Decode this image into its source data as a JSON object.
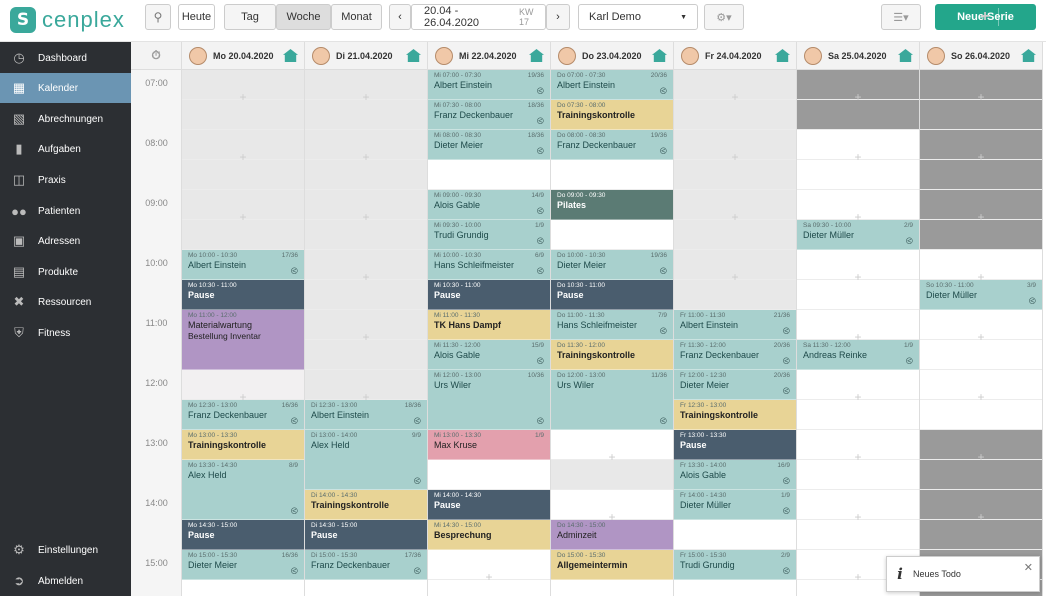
{
  "topbar": {
    "logo_text": "cenplex",
    "today": "Heute",
    "views": [
      "Tag",
      "Woche",
      "Monat"
    ],
    "range": "20.04 - 26.04.2020",
    "week": "KW 17",
    "user": "Karl Demo",
    "new_series": "Neue Serie"
  },
  "sidebar": {
    "items": [
      {
        "label": "Dashboard",
        "icon": "dashboard-icon"
      },
      {
        "label": "Kalender",
        "icon": "calendar-icon"
      },
      {
        "label": "Abrechnungen",
        "icon": "calculator-icon"
      },
      {
        "label": "Aufgaben",
        "icon": "clipboard-icon"
      },
      {
        "label": "Praxis",
        "icon": "building-icon"
      },
      {
        "label": "Patienten",
        "icon": "users-icon"
      },
      {
        "label": "Adressen",
        "icon": "contact-icon"
      },
      {
        "label": "Produkte",
        "icon": "store-icon"
      },
      {
        "label": "Ressourcen",
        "icon": "tools-icon"
      },
      {
        "label": "Fitness",
        "icon": "shield-icon"
      }
    ],
    "bottom": [
      {
        "label": "Einstellungen",
        "icon": "gear-icon"
      },
      {
        "label": "Abmelden",
        "icon": "logout-icon"
      }
    ]
  },
  "times": [
    "07:00",
    "08:00",
    "09:00",
    "10:00",
    "11:00",
    "12:00",
    "13:00",
    "14:00",
    "15:00"
  ],
  "days": [
    {
      "label": "Mo 20.04.2020",
      "home_count": "1"
    },
    {
      "label": "Di 21.04.2020",
      "home_count": "1"
    },
    {
      "label": "Mi 22.04.2020",
      "home_count": "1"
    },
    {
      "label": "Do 23.04.2020",
      "home_count": "1"
    },
    {
      "label": "Fr 24.04.2020",
      "home_count": "1"
    },
    {
      "label": "Sa 25.04.2020",
      "home_count": "1"
    },
    {
      "label": "So 26.04.2020",
      "home_count": "1"
    }
  ],
  "events": [
    {
      "day": 0,
      "slot": 6,
      "color": "teal",
      "time": "Mo 10:00 - 10:30",
      "count": "17/36",
      "name": "Albert Einstein"
    },
    {
      "day": 0,
      "slot": 7,
      "color": "dark",
      "time": "Mo 10:30 - 11:00",
      "count": "",
      "name": "Pause"
    },
    {
      "day": 0,
      "slot": 8,
      "color": "purple",
      "time": "Mo 11:00 - 12:00",
      "count": "",
      "name": "Materialwartung",
      "span": 2,
      "extra": "Bestellung Inventar"
    },
    {
      "day": 0,
      "slot": 11,
      "color": "teal",
      "time": "Mo 12:30 - 13:00",
      "count": "16/36",
      "name": "Franz Deckenbauer"
    },
    {
      "day": 0,
      "slot": 12,
      "color": "yellow",
      "time": "Mo 13:00 - 13:30",
      "count": "",
      "name": "Trainingskontrolle"
    },
    {
      "day": 0,
      "slot": 13,
      "color": "teal",
      "time": "Mo 13:30 - 14:30",
      "count": "8/9",
      "name": "Alex Held",
      "span": 2
    },
    {
      "day": 0,
      "slot": 15,
      "color": "dark",
      "time": "Mo 14:30 - 15:00",
      "count": "",
      "name": "Pause"
    },
    {
      "day": 0,
      "slot": 16,
      "color": "teal",
      "time": "Mo 15:00 - 15:30",
      "count": "16/36",
      "name": "Dieter Meier"
    },
    {
      "day": 1,
      "slot": 11,
      "color": "teal",
      "time": "Di 12:30 - 13:00",
      "count": "18/36",
      "name": "Albert Einstein"
    },
    {
      "day": 1,
      "slot": 12,
      "color": "teal",
      "time": "Di 13:00 - 14:00",
      "count": "9/9",
      "name": "Alex Held",
      "span": 2
    },
    {
      "day": 1,
      "slot": 14,
      "color": "yellow",
      "time": "Di 14:00 - 14:30",
      "count": "",
      "name": "Trainingskontrolle"
    },
    {
      "day": 1,
      "slot": 15,
      "color": "dark",
      "time": "Di 14:30 - 15:00",
      "count": "",
      "name": "Pause"
    },
    {
      "day": 1,
      "slot": 16,
      "color": "teal",
      "time": "Di 15:00 - 15:30",
      "count": "17/36",
      "name": "Franz Deckenbauer"
    },
    {
      "day": 2,
      "slot": 0,
      "color": "teal",
      "time": "Mi 07:00 - 07:30",
      "count": "19/36",
      "name": "Albert Einstein"
    },
    {
      "day": 2,
      "slot": 1,
      "color": "teal",
      "time": "Mi 07:30 - 08:00",
      "count": "18/36",
      "name": "Franz Deckenbauer"
    },
    {
      "day": 2,
      "slot": 2,
      "color": "teal",
      "time": "Mi 08:00 - 08:30",
      "count": "18/36",
      "name": "Dieter Meier"
    },
    {
      "day": 2,
      "slot": 4,
      "color": "teal",
      "time": "Mi 09:00 - 09:30",
      "count": "14/9",
      "name": "Alois Gable"
    },
    {
      "day": 2,
      "slot": 5,
      "color": "teal",
      "time": "Mi 09:30 - 10:00",
      "count": "1/9",
      "name": "Trudi Grundig"
    },
    {
      "day": 2,
      "slot": 6,
      "color": "teal",
      "time": "Mi 10:00 - 10:30",
      "count": "6/9",
      "name": "Hans Schleifmeister"
    },
    {
      "day": 2,
      "slot": 7,
      "color": "dark",
      "time": "Mi 10:30 - 11:00",
      "count": "",
      "name": "Pause"
    },
    {
      "day": 2,
      "slot": 8,
      "color": "yellow",
      "time": "Mi 11:00 - 11:30",
      "count": "",
      "name": "TK Hans Dampf"
    },
    {
      "day": 2,
      "slot": 9,
      "color": "teal",
      "time": "Mi 11:30 - 12:00",
      "count": "15/9",
      "name": "Alois Gable"
    },
    {
      "day": 2,
      "slot": 10,
      "color": "teal",
      "time": "Mi 12:00 - 13:00",
      "count": "10/36",
      "name": "Urs Wiler",
      "span": 2
    },
    {
      "day": 2,
      "slot": 12,
      "color": "pink",
      "time": "Mi 13:00 - 13:30",
      "count": "1/9",
      "name": "Max Kruse"
    },
    {
      "day": 2,
      "slot": 14,
      "color": "dark",
      "time": "Mi 14:00 - 14:30",
      "count": "",
      "name": "Pause"
    },
    {
      "day": 2,
      "slot": 15,
      "color": "yellow",
      "time": "Mi 14:30 - 15:00",
      "count": "",
      "name": "Besprechung"
    },
    {
      "day": 3,
      "slot": 0,
      "color": "teal",
      "time": "Do 07:00 - 07:30",
      "count": "20/36",
      "name": "Albert Einstein"
    },
    {
      "day": 3,
      "slot": 1,
      "color": "yellow",
      "time": "Do 07:30 - 08:00",
      "count": "",
      "name": "Trainingskontrolle"
    },
    {
      "day": 3,
      "slot": 2,
      "color": "teal",
      "time": "Do 08:00 - 08:30",
      "count": "19/36",
      "name": "Franz Deckenbauer"
    },
    {
      "day": 3,
      "slot": 4,
      "color": "green",
      "time": "Do 09:00 - 09:30",
      "count": "",
      "name": "Pilates"
    },
    {
      "day": 3,
      "slot": 6,
      "color": "teal",
      "time": "Do 10:00 - 10:30",
      "count": "19/36",
      "name": "Dieter Meier"
    },
    {
      "day": 3,
      "slot": 7,
      "color": "dark",
      "time": "Do 10:30 - 11:00",
      "count": "",
      "name": "Pause"
    },
    {
      "day": 3,
      "slot": 8,
      "color": "teal",
      "time": "Do 11:00 - 11:30",
      "count": "7/9",
      "name": "Hans Schleifmeister"
    },
    {
      "day": 3,
      "slot": 9,
      "color": "yellow",
      "time": "Do 11:30 - 12:00",
      "count": "",
      "name": "Trainingskontrolle"
    },
    {
      "day": 3,
      "slot": 10,
      "color": "teal",
      "time": "Do 12:00 - 13:00",
      "count": "11/36",
      "name": "Urs Wiler",
      "span": 2
    },
    {
      "day": 3,
      "slot": 15,
      "color": "purple",
      "time": "Do 14:30 - 15:00",
      "count": "",
      "name": "Adminzeit"
    },
    {
      "day": 3,
      "slot": 16,
      "color": "yellow",
      "time": "Do 15:00 - 15:30",
      "count": "",
      "name": "Allgemeintermin"
    },
    {
      "day": 4,
      "slot": 8,
      "color": "teal",
      "time": "Fr 11:00 - 11:30",
      "count": "21/36",
      "name": "Albert Einstein"
    },
    {
      "day": 4,
      "slot": 9,
      "color": "teal",
      "time": "Fr 11:30 - 12:00",
      "count": "20/36",
      "name": "Franz Deckenbauer"
    },
    {
      "day": 4,
      "slot": 10,
      "color": "teal",
      "time": "Fr 12:00 - 12:30",
      "count": "20/36",
      "name": "Dieter Meier"
    },
    {
      "day": 4,
      "slot": 11,
      "color": "yellow",
      "time": "Fr 12:30 - 13:00",
      "count": "",
      "name": "Trainingskontrolle"
    },
    {
      "day": 4,
      "slot": 12,
      "color": "dark",
      "time": "Fr 13:00 - 13:30",
      "count": "",
      "name": "Pause"
    },
    {
      "day": 4,
      "slot": 13,
      "color": "teal",
      "time": "Fr 13:30 - 14:00",
      "count": "16/9",
      "name": "Alois Gable"
    },
    {
      "day": 4,
      "slot": 14,
      "color": "teal",
      "time": "Fr 14:00 - 14:30",
      "count": "1/9",
      "name": "Dieter Müller"
    },
    {
      "day": 4,
      "slot": 16,
      "color": "teal",
      "time": "Fr 15:00 - 15:30",
      "count": "2/9",
      "name": "Trudi Grundig"
    },
    {
      "day": 5,
      "slot": 5,
      "color": "teal",
      "time": "Sa 09:30 - 10:00",
      "count": "2/9",
      "name": "Dieter Müller"
    },
    {
      "day": 5,
      "slot": 9,
      "color": "teal",
      "time": "Sa 11:30 - 12:00",
      "count": "1/9",
      "name": "Andreas Reinke"
    },
    {
      "day": 6,
      "slot": 7,
      "color": "teal",
      "time": "So 10:30 - 11:00",
      "count": "3/9",
      "name": "Dieter Müller"
    }
  ],
  "toast": {
    "text": "Neues Todo"
  }
}
